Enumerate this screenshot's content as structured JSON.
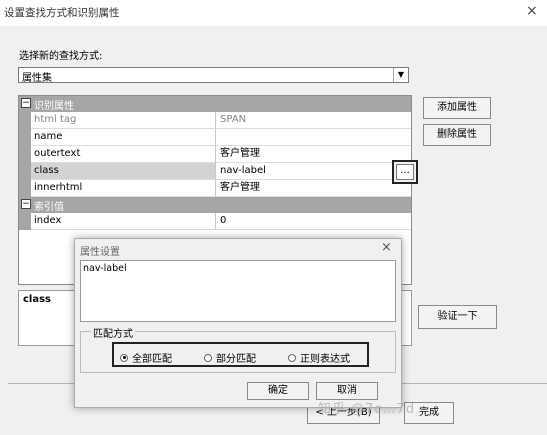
{
  "window": {
    "title": "设置查找方式和识别属性",
    "close": "×"
  },
  "find_method": {
    "label": "选择新的查找方式:",
    "selected": "属性集"
  },
  "grid": {
    "category1": {
      "toggle": "日",
      "label": "识别属性"
    },
    "rows1": [
      {
        "name": "html tag",
        "value": "SPAN"
      },
      {
        "name": "name",
        "value": ""
      },
      {
        "name": "outertext",
        "value": "客户管理"
      },
      {
        "name": "class",
        "value": "nav-label"
      },
      {
        "name": "innerhtml",
        "value": "客户管理"
      }
    ],
    "category2": {
      "toggle": "日",
      "label": "索引值"
    },
    "rows2": [
      {
        "name": "index",
        "value": "0"
      }
    ],
    "ellipsis": "..."
  },
  "buttons": {
    "add": "添加属性",
    "remove": "删除属性",
    "verify": "验证一下",
    "prev": "< 上一步(B)",
    "finish": "完成"
  },
  "description": {
    "label": "class"
  },
  "dialog": {
    "title": "属性设置",
    "close": "×",
    "text": "nav-label",
    "match_label": "匹配方式",
    "options": [
      "全部匹配",
      "部分匹配",
      "正则表达式"
    ],
    "selected_index": 0,
    "ok": "确定",
    "cancel": "取消"
  },
  "watermark": "知乎 @7c…7d"
}
